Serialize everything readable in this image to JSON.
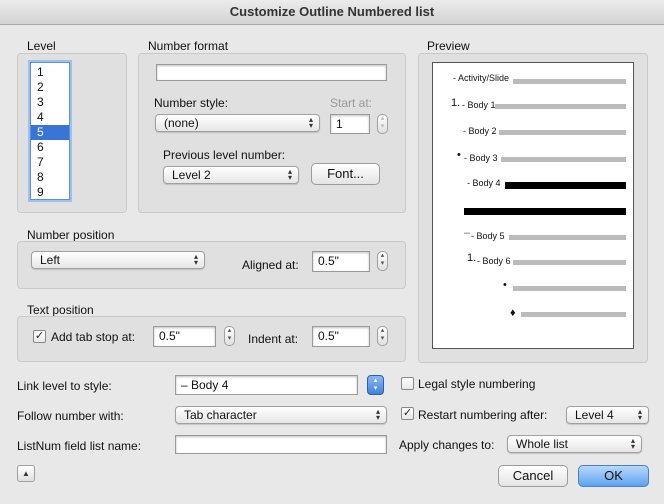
{
  "window": {
    "title": "Customize Outline Numbered list"
  },
  "level": {
    "heading": "Level",
    "items": [
      "1",
      "2",
      "3",
      "4",
      "5",
      "6",
      "7",
      "8",
      "9"
    ],
    "selected_index": 4
  },
  "number_format": {
    "heading": "Number format",
    "format_value": "",
    "style_label": "Number style:",
    "style_value": "(none)",
    "start_label": "Start at:",
    "start_value": "1",
    "prev_label": "Previous level number:",
    "prev_value": "Level 2",
    "font_button": "Font..."
  },
  "preview": {
    "heading": "Preview",
    "lines": [
      {
        "prefix": "",
        "text": "- Activity/Slide"
      },
      {
        "prefix": "1.",
        "text": "- Body 1"
      },
      {
        "prefix": "",
        "text": "- Body 2"
      },
      {
        "prefix": "•",
        "text": "- Body 3"
      },
      {
        "prefix": "",
        "text": "- Body 4"
      },
      {
        "prefix": "–",
        "text": "- Body 5"
      },
      {
        "prefix": "1.",
        "text": "- Body 6"
      },
      {
        "prefix": "•",
        "text": ""
      },
      {
        "prefix": "♦",
        "text": ""
      }
    ]
  },
  "number_position": {
    "heading": "Number position",
    "value": "Left",
    "aligned_label": "Aligned at:",
    "aligned_value": "0.5\""
  },
  "text_position": {
    "heading": "Text position",
    "add_tab_label": "Add tab stop at:",
    "add_tab_checked": true,
    "tab_value": "0.5\"",
    "indent_label": "Indent at:",
    "indent_value": "0.5\""
  },
  "bottom": {
    "link_label": "Link level to style:",
    "link_value": "– Body 4",
    "follow_label": "Follow number with:",
    "follow_value": "Tab character",
    "listnum_label": "ListNum field list name:",
    "listnum_value": "",
    "legal_label": "Legal style numbering",
    "legal_checked": false,
    "restart_label": "Restart numbering after:",
    "restart_checked": true,
    "restart_value": "Level 4",
    "apply_label": "Apply changes to:",
    "apply_value": "Whole list"
  },
  "buttons": {
    "cancel": "Cancel",
    "ok": "OK"
  },
  "colors": {
    "accent": "#3875d7",
    "ok_button": "#5da2ef"
  }
}
